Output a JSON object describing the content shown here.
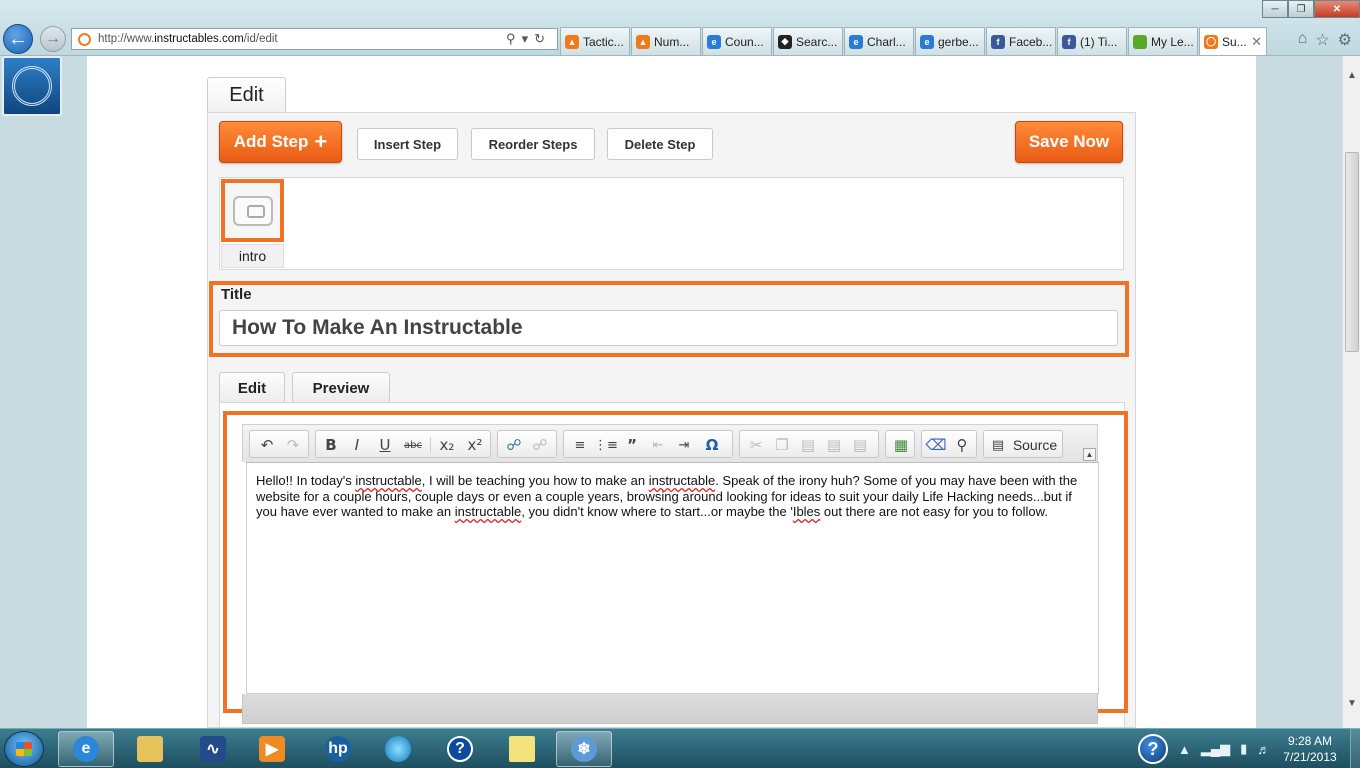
{
  "browser": {
    "url_prefix": "http://www.",
    "url_host": "instructables.com",
    "url_path": "/id/edit",
    "tabs": [
      {
        "label": "Tactic...",
        "icon": "flame-icon",
        "color": "#f07a1a"
      },
      {
        "label": "Num...",
        "icon": "flame-icon",
        "color": "#f07a1a"
      },
      {
        "label": "Coun...",
        "icon": "ie-icon",
        "color": "#2a7bd5"
      },
      {
        "label": "Searc...",
        "icon": "shield-icon",
        "color": "#222222"
      },
      {
        "label": "Charl...",
        "icon": "ie-icon",
        "color": "#2a7bd5"
      },
      {
        "label": "gerbe...",
        "icon": "ie-icon",
        "color": "#2a7bd5"
      },
      {
        "label": "Faceb...",
        "icon": "facebook-icon",
        "color": "#3b5998"
      },
      {
        "label": "(1) Ti...",
        "icon": "facebook-icon",
        "color": "#3b5998"
      },
      {
        "label": "My Le...",
        "icon": "square-icon",
        "color": "#5aa82b"
      },
      {
        "label": "Su...",
        "icon": "instructables-icon",
        "color": "#f07a1a",
        "active": true
      }
    ]
  },
  "editor": {
    "top_tab": "Edit",
    "add_step": "Add Step",
    "add_step_plus": "+",
    "insert_step": "Insert Step",
    "reorder_steps": "Reorder Steps",
    "delete_step": "Delete Step",
    "save_now": "Save Now",
    "step_label": "intro",
    "title_label": "Title",
    "title_value": "How To Make An Instructable",
    "subtab_edit": "Edit",
    "subtab_preview": "Preview",
    "source_label": "Source",
    "body_text": [
      {
        "t": "Hello!! In today's "
      },
      {
        "t": "instructable",
        "sp": true
      },
      {
        "t": ", I will be teaching you how to make an "
      },
      {
        "t": "instructable",
        "sp": true
      },
      {
        "t": ". Speak of the irony huh? Some of you may have been with the website for a couple hours, couple days or even a couple years, browsing around looking for ideas to suit your daily Life Hacking needs...but if you have ever wanted to make an "
      },
      {
        "t": "instructable",
        "sp": true
      },
      {
        "t": ", you didn't know where to start...or maybe the '"
      },
      {
        "t": "Ibles",
        "sp": true
      },
      {
        "t": " out there are not easy for you to follow."
      }
    ]
  },
  "colors": {
    "accent": "#f07222"
  },
  "taskbar": {
    "time": "9:28 AM",
    "date": "7/21/2013"
  }
}
